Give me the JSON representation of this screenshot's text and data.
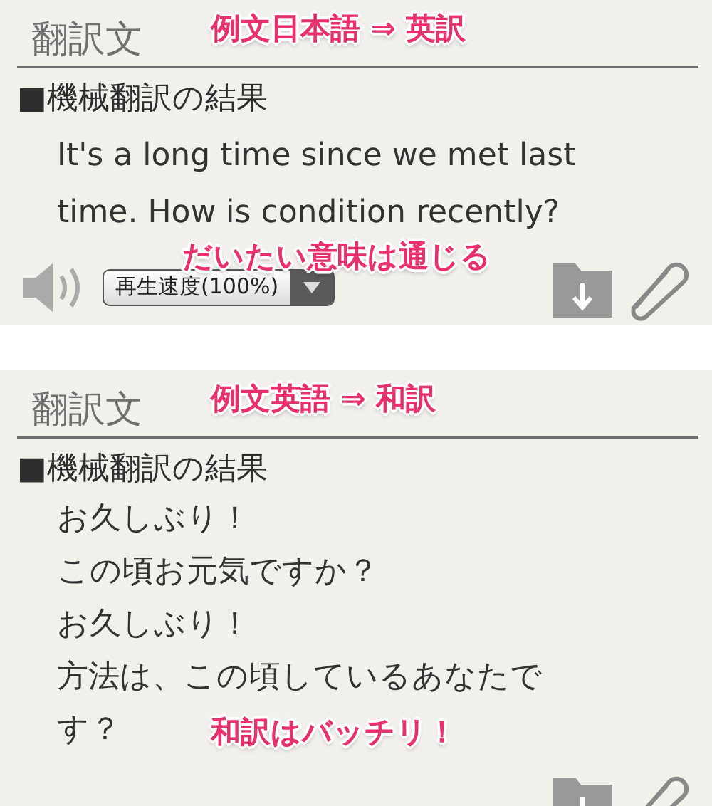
{
  "panels": [
    {
      "header": "翻訳文",
      "annotation": "例文日本語 ⇒ 英訳",
      "section_title": "■機械翻訳の結果",
      "text": "It's a long time since we met last time. How is condition recently?",
      "note": "だいたい意味は通じる",
      "toolbar": [
        {
          "kind": "speaker"
        },
        {
          "kind": "select",
          "label": "再生速度(100%)"
        },
        {
          "kind": "save"
        },
        {
          "kind": "attach"
        }
      ]
    },
    {
      "header": "翻訳文",
      "annotation": "例文英語 ⇒ 和訳",
      "section_title": "■機械翻訳の結果",
      "lines": [
        "お久しぶり！",
        "この頃お元気ですか？",
        "お久しぶり！",
        "方法は、この頃しているあなたで",
        "す？"
      ],
      "note": "和訳はバッチリ！",
      "toolbar": [
        {
          "kind": "save"
        },
        {
          "kind": "attach"
        }
      ]
    }
  ]
}
